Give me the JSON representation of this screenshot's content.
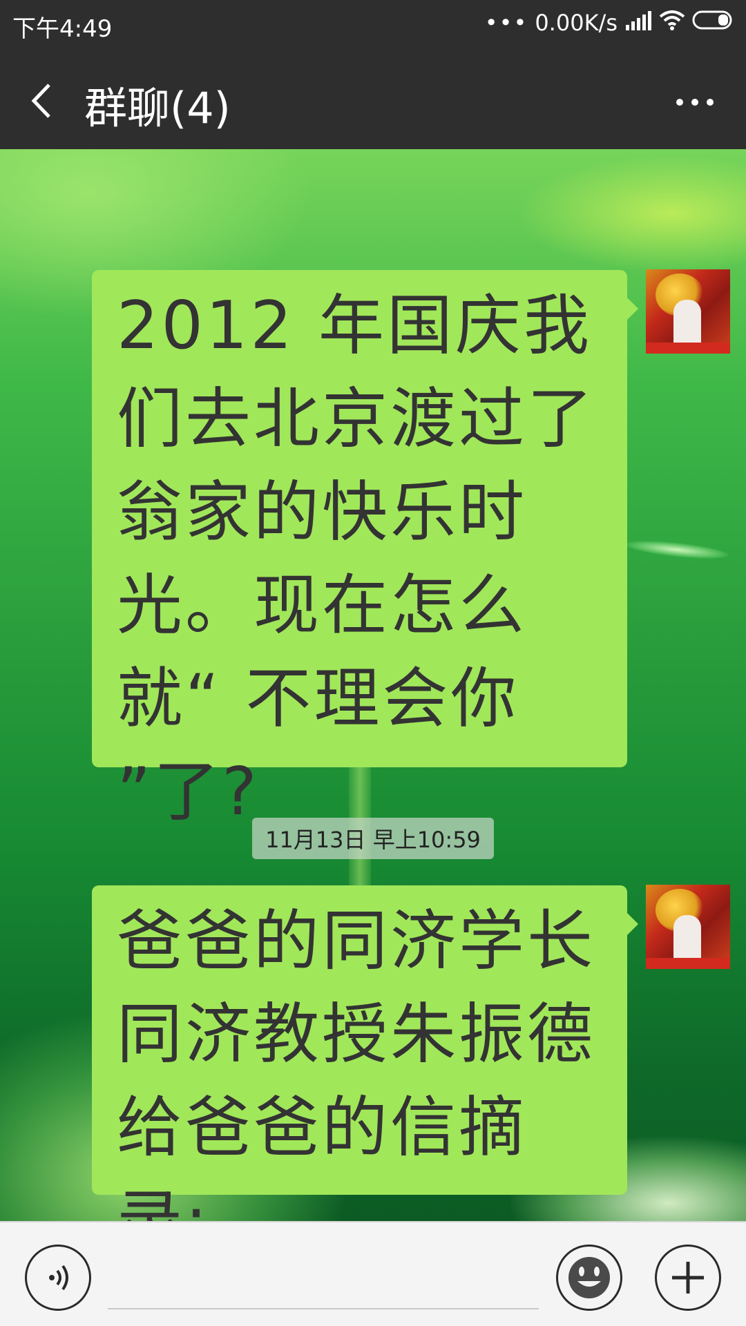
{
  "status_bar": {
    "time": "下午4:49",
    "net_speed": "0.00K/s",
    "icons": [
      "more-dots-icon",
      "signal-icon",
      "wifi-icon",
      "battery-icon"
    ]
  },
  "header": {
    "title": "群聊(4)",
    "back_icon": "chevron-left-icon",
    "more_icon": "more-horizontal-icon"
  },
  "messages": [
    {
      "text": "2012 年国庆我们去北京渡过了翁家的快乐时光。现在怎么就“ 不理会你 ”了?",
      "side": "right"
    },
    {
      "text": "爸爸的同济学长同济教授朱振德给爸爸的信摘录:",
      "side": "right"
    }
  ],
  "timestamp": "11月13日 早上10:59",
  "input_bar": {
    "voice_icon": "voice-icon",
    "emoji_icon": "emoji-icon",
    "plus_icon": "plus-icon",
    "placeholder": ""
  },
  "colors": {
    "bubble": "#a1e75a",
    "header": "#2e2e2e",
    "input_bar": "#f4f4f4"
  }
}
